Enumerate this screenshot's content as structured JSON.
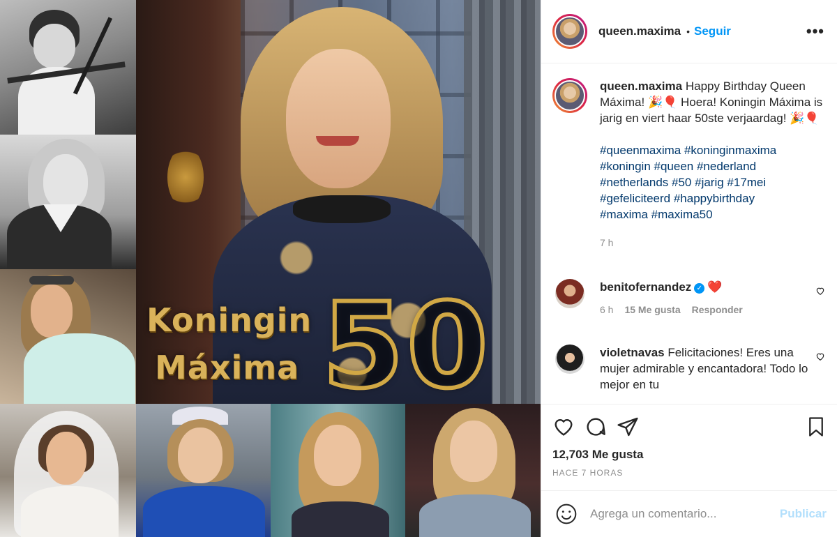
{
  "post": {
    "image_overlay": {
      "line1": "Koningin",
      "line2": "Máxima",
      "number": "50"
    }
  },
  "header": {
    "username": "queen.maxima",
    "separator": "•",
    "follow_label": "Seguir",
    "more_label": "•••"
  },
  "caption": {
    "username": "queen.maxima",
    "text": "Happy Birthday Queen Máxima! 🎉🎈 Hoera! Koningin Máxima is jarig en viert haar 50ste verjaardag! 🎉🎈",
    "hashtag_lines": [
      "#queenmaxima #koninginmaxima",
      "#koningin #queen #nederland",
      "#netherlands #50 #jarig #17mei",
      "#gefeliciteerd #happybirthday",
      "#maxima #maxima50"
    ],
    "time": "7 h"
  },
  "comments": [
    {
      "username": "benitofernandez",
      "verified": true,
      "text": "❤️",
      "time": "6 h",
      "likes": "15 Me gusta",
      "reply_label": "Responder",
      "avatar_color": "#8a3b2c"
    },
    {
      "username": "violetnavas",
      "verified": false,
      "text": "Felicitaciones! Eres una mujer admirable y encantadora! Todo lo mejor en tu",
      "avatar_color": "#2b2b2b"
    }
  ],
  "actions": {
    "likes_count": "12,703 Me gusta",
    "posted_ago": "HACE 7 HORAS"
  },
  "comment_box": {
    "placeholder": "Agrega un comentario...",
    "publish_label": "Publicar"
  },
  "colors": {
    "accent_blue": "#0095f6",
    "hashtag_blue": "#00376b",
    "muted_gray": "#8e8e8e",
    "publish_disabled": "#b2dffc",
    "gold_text": "#d9b25a"
  }
}
